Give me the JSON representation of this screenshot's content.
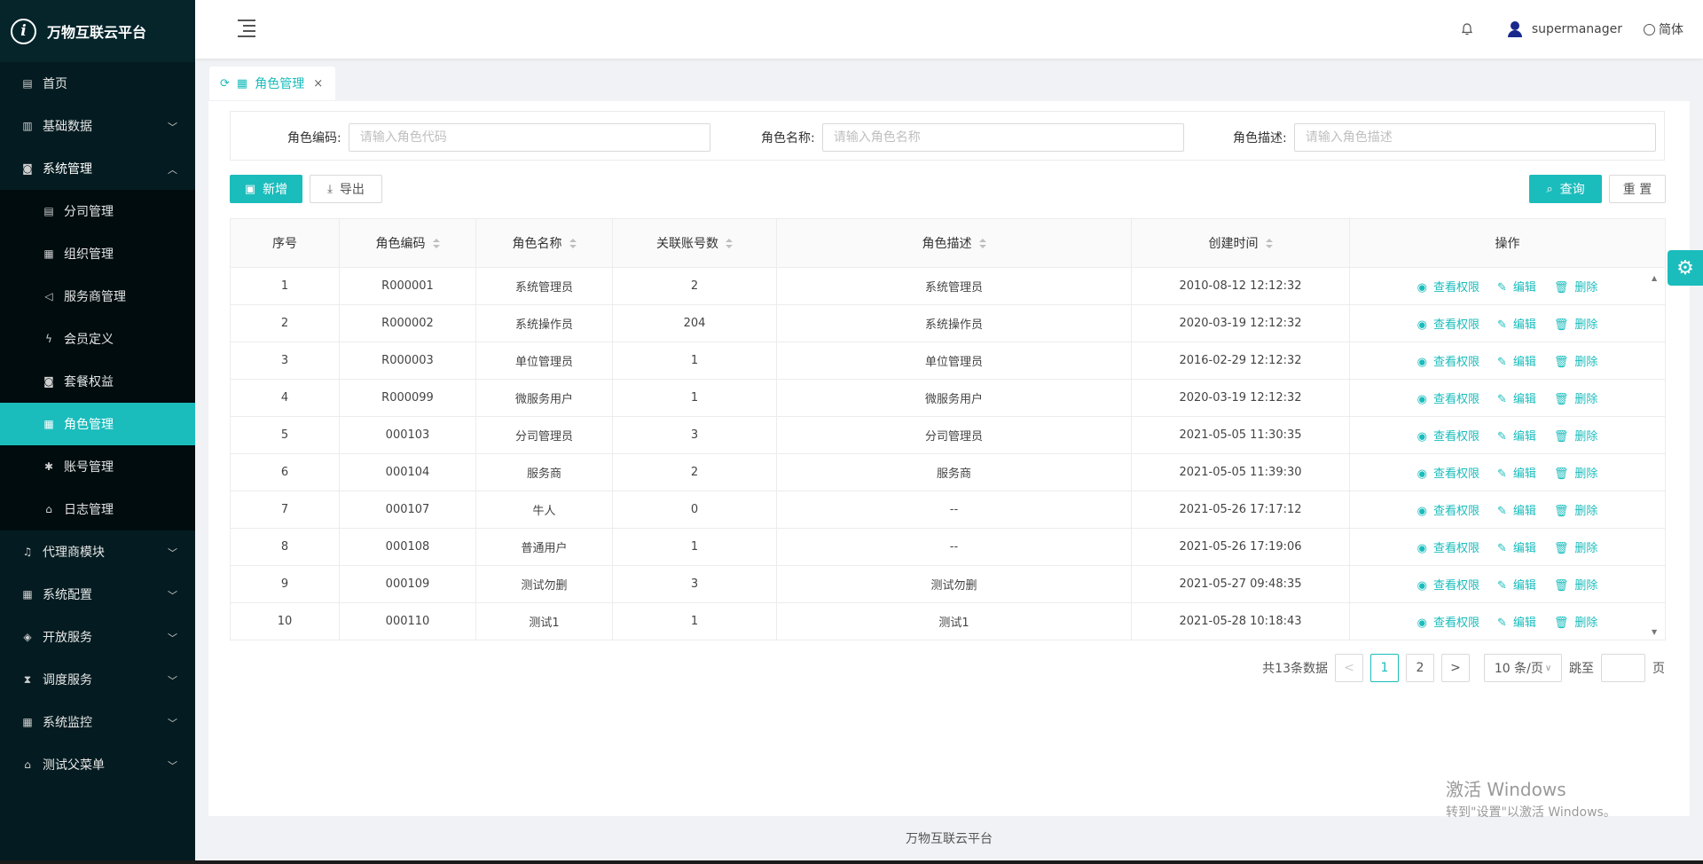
{
  "app": {
    "title": "万物互联云平台",
    "logo_glyph": "i"
  },
  "sidebar": {
    "items": [
      {
        "label": "首页",
        "icon": "calendar-icon",
        "glyph": "▤"
      },
      {
        "label": "基础数据",
        "icon": "barcode-icon",
        "glyph": "▥",
        "expandable": true
      },
      {
        "label": "系统管理",
        "icon": "camera-icon",
        "glyph": "◙",
        "expandable": true,
        "open": true,
        "children": [
          {
            "label": "分司管理",
            "icon": "calendar-icon",
            "glyph": "▤"
          },
          {
            "label": "组织管理",
            "icon": "grid-icon",
            "glyph": "▦"
          },
          {
            "label": "服务商管理",
            "icon": "megaphone-icon",
            "glyph": "◁"
          },
          {
            "label": "会员定义",
            "icon": "bolt-icon",
            "glyph": "ϟ"
          },
          {
            "label": "套餐权益",
            "icon": "camera-icon",
            "glyph": "◙"
          },
          {
            "label": "角色管理",
            "icon": "grid-icon",
            "glyph": "▦",
            "active": true
          },
          {
            "label": "账号管理",
            "icon": "bug-icon",
            "glyph": "✱"
          },
          {
            "label": "日志管理",
            "icon": "home-icon",
            "glyph": "⌂"
          }
        ]
      },
      {
        "label": "代理商模块",
        "icon": "bell-icon",
        "glyph": "♫",
        "expandable": true
      },
      {
        "label": "系统配置",
        "icon": "grid-icon",
        "glyph": "▦",
        "expandable": true
      },
      {
        "label": "开放服务",
        "icon": "tag-icon",
        "glyph": "◈",
        "expandable": true
      },
      {
        "label": "调度服务",
        "icon": "hourglass-icon",
        "glyph": "⧗",
        "expandable": true
      },
      {
        "label": "系统监控",
        "icon": "grid-icon",
        "glyph": "▦",
        "expandable": true
      },
      {
        "label": "测试父菜单",
        "icon": "bank-icon",
        "glyph": "⌂",
        "expandable": true
      }
    ]
  },
  "header": {
    "user": "supermanager",
    "lang": "简体"
  },
  "tab": {
    "label": "角色管理"
  },
  "filter": {
    "code_label": "角色编码:",
    "code_placeholder": "请输入角色代码",
    "name_label": "角色名称:",
    "name_placeholder": "请输入角色名称",
    "desc_label": "角色描述:",
    "desc_placeholder": "请输入角色描述"
  },
  "toolbar": {
    "add": "新增",
    "export": "导出",
    "query": "查询",
    "reset": "重 置"
  },
  "table": {
    "columns": [
      "序号",
      "角色编码",
      "角色名称",
      "关联账号数",
      "角色描述",
      "创建时间",
      "操作"
    ],
    "ops": {
      "view": "查看权限",
      "edit": "编辑",
      "delete": "删除"
    },
    "rows": [
      [
        "1",
        "R000001",
        "系统管理员",
        "2",
        "系统管理员",
        "2010-08-12 12:12:32"
      ],
      [
        "2",
        "R000002",
        "系统操作员",
        "204",
        "系统操作员",
        "2020-03-19 12:12:32"
      ],
      [
        "3",
        "R000003",
        "单位管理员",
        "1",
        "单位管理员",
        "2016-02-29 12:12:32"
      ],
      [
        "4",
        "R000099",
        "微服务用户",
        "1",
        "微服务用户",
        "2020-03-19 12:12:32"
      ],
      [
        "5",
        "000103",
        "分司管理员",
        "3",
        "分司管理员",
        "2021-05-05 11:30:35"
      ],
      [
        "6",
        "000104",
        "服务商",
        "2",
        "服务商",
        "2021-05-05 11:39:30"
      ],
      [
        "7",
        "000107",
        "牛人",
        "0",
        "--",
        "2021-05-26 17:17:12"
      ],
      [
        "8",
        "000108",
        "普通用户",
        "1",
        "--",
        "2021-05-26 17:19:06"
      ],
      [
        "9",
        "000109",
        "测试勿删",
        "3",
        "测试勿删",
        "2021-05-27 09:48:35"
      ],
      [
        "10",
        "000110",
        "测试1",
        "1",
        "测试1",
        "2021-05-28 10:18:43"
      ]
    ]
  },
  "pagination": {
    "total_text": "共13条数据",
    "prev": "<",
    "next": ">",
    "pages": [
      "1",
      "2"
    ],
    "current": "1",
    "page_size": "10 条/页",
    "jump_label": "跳至",
    "page_unit": "页"
  },
  "watermark": {
    "line1": "激活 Windows",
    "line2": "转到\"设置\"以激活 Windows。"
  },
  "footer": {
    "text": "万物互联云平台"
  },
  "colors": {
    "accent": "#1bbcbc",
    "sidebar_bg": "#041c21"
  }
}
